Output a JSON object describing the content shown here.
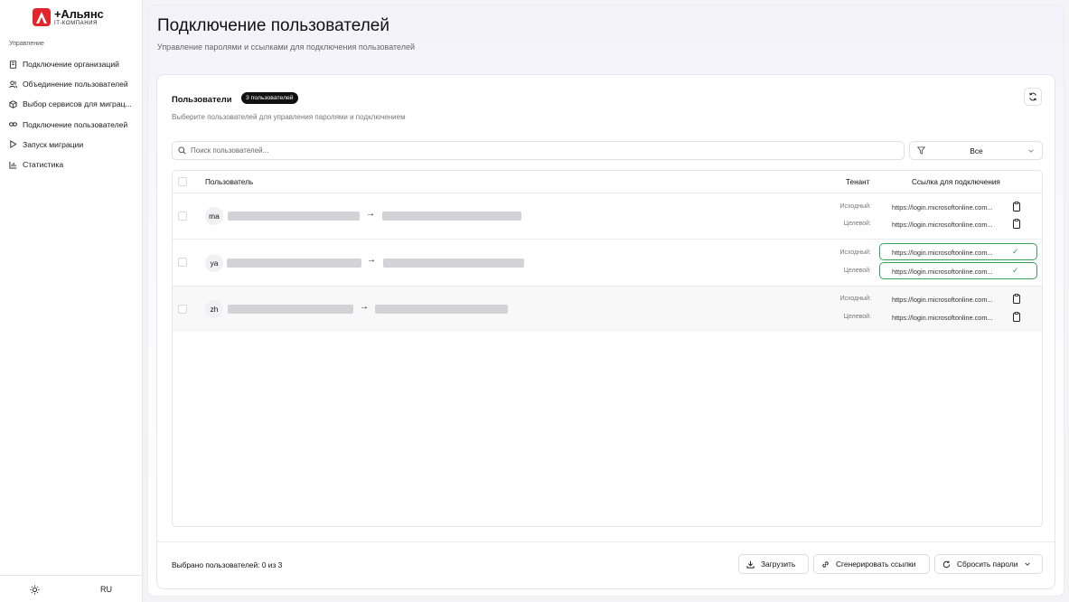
{
  "brand": {
    "name": "+Альянс",
    "subtitle": "IT-КОМПАНИЯ"
  },
  "sidebar": {
    "section": "Управление",
    "items": [
      {
        "label": "Подключение организаций",
        "icon": "building-icon"
      },
      {
        "label": "Объединение пользователей",
        "icon": "users-icon"
      },
      {
        "label": "Выбор сервисов для миграц...",
        "icon": "package-icon"
      },
      {
        "label": "Подключение пользователей",
        "icon": "link-icon"
      },
      {
        "label": "Запуск миграции",
        "icon": "play-icon"
      },
      {
        "label": "Статистика",
        "icon": "chart-icon"
      }
    ],
    "language": "RU"
  },
  "page": {
    "title": "Подключение пользователей",
    "subtitle": "Управление паролями и ссылками для подключения пользователей"
  },
  "card": {
    "title": "Пользователи",
    "badge": "3 пользователей",
    "subtitle": "Выберите пользователей для управления паролями и подключением",
    "search_placeholder": "Поиск пользователей...",
    "filter_value": "Все"
  },
  "table": {
    "headers": {
      "user": "Пользователь",
      "tenant": "Тенант",
      "link": "Ссылка для подключения"
    },
    "rows": [
      {
        "initials": "ma",
        "source_label": "Исходный:",
        "target_label": "Целевой:",
        "source_link": "https://login.microsoftonline.com...",
        "target_link": "https://login.microsoftonline.com..."
      },
      {
        "initials": "ya",
        "source_label": "Исходный:",
        "target_label": "Целевой:",
        "source_link": "https://login.microsoftonline.com...",
        "target_link": "https://login.microsoftonline.com..."
      },
      {
        "initials": "zh",
        "source_label": "Исходный:",
        "target_label": "Целевой:",
        "source_link": "https://login.microsoftonline.com...",
        "target_link": "https://login.microsoftonline.com..."
      }
    ]
  },
  "footer": {
    "selected": "Выбрано пользователей: 0 из 3",
    "upload": "Загрузить",
    "generate": "Сгенерировать ссылки",
    "reset": "Сбросить пароли"
  }
}
